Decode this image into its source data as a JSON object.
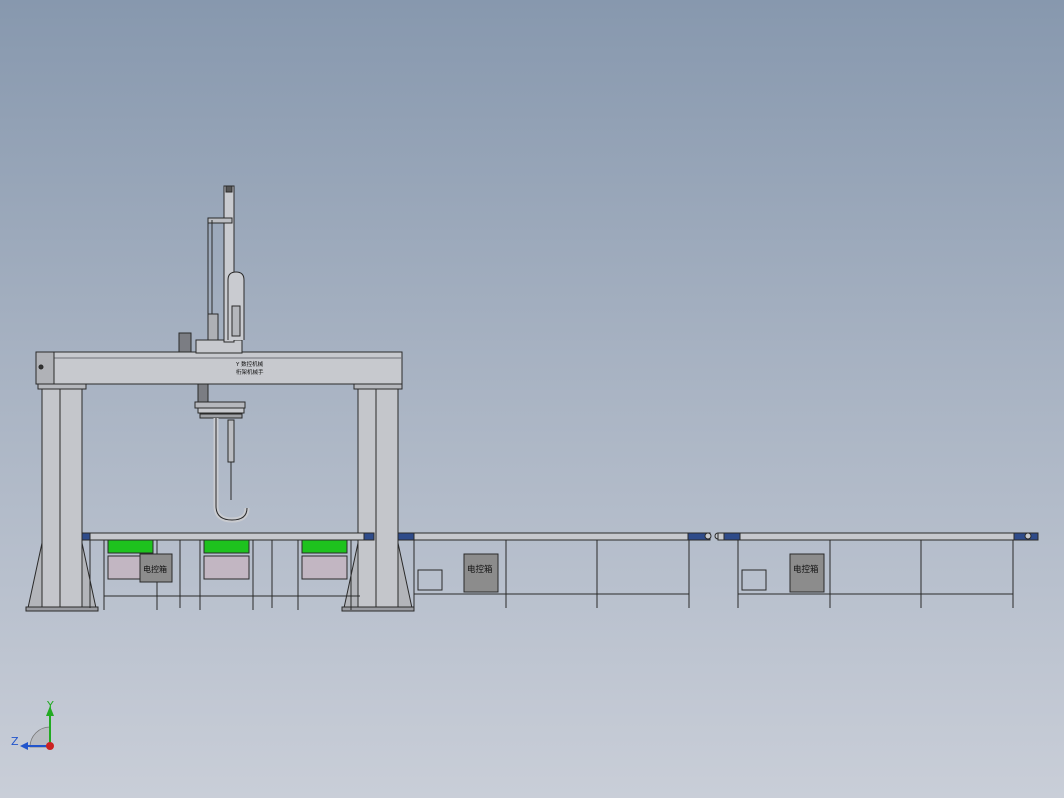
{
  "drawing": {
    "gantry_brand_line1": "Y 数控机械",
    "gantry_brand_line2": "桁架机械手",
    "control_box_label": "电控箱"
  },
  "triad": {
    "y_label": "Y",
    "z_label": "Z"
  },
  "colors": {
    "background_top": "#8798ae",
    "background_bottom": "#c9ced8",
    "steel": "#c4c6cb",
    "steel_dark": "#9a9ca2",
    "conveyor_belt_green": "#1ec21e",
    "tray": "#c2b6c2",
    "control_box": "#8c8c8c",
    "rail_end_blue": "#2e4b8a",
    "axis_y": "#22aa22",
    "axis_z": "#2255cc",
    "origin": "#cc2222"
  }
}
